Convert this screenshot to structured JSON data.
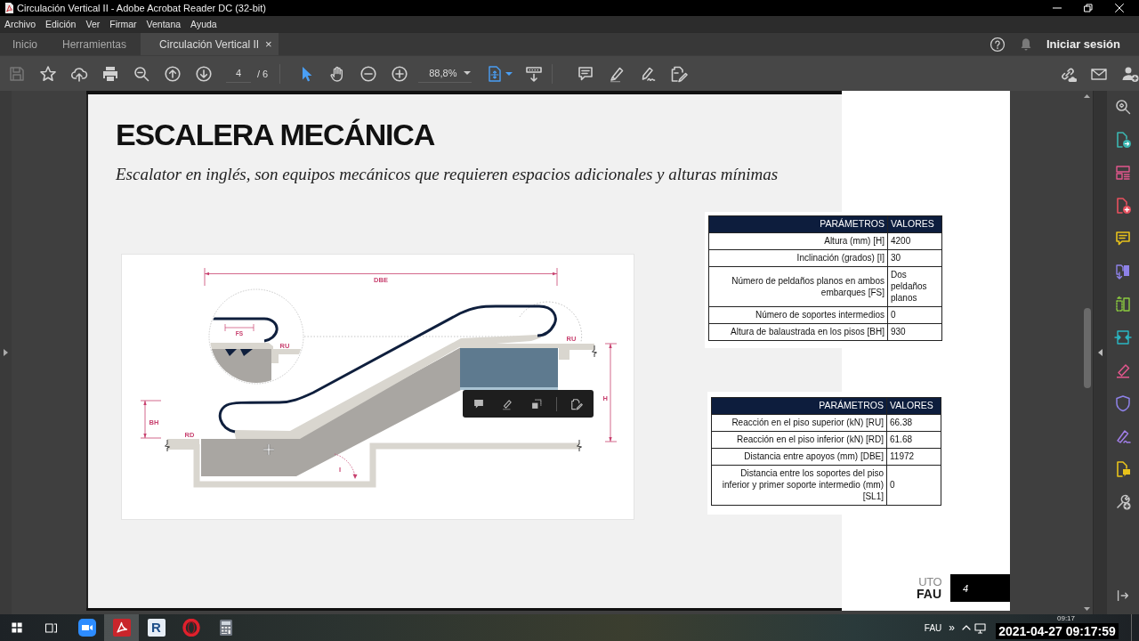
{
  "window": {
    "title": "Circulación Vertical II - Adobe Acrobat Reader DC (32-bit)"
  },
  "menu": [
    "Archivo",
    "Edición",
    "Ver",
    "Firmar",
    "Ventana",
    "Ayuda"
  ],
  "tabs": [
    {
      "label": "Inicio",
      "selected": false
    },
    {
      "label": "Herramientas",
      "selected": false
    },
    {
      "label": "Circulación Vertical II",
      "selected": true,
      "close": "×"
    }
  ],
  "account": {
    "sign_in": "Iniciar sesión"
  },
  "toolbar": {
    "save": {
      "disabled": true
    },
    "page": "4",
    "page_total": "/ 6",
    "pointer_tool": {
      "selected": true
    },
    "hand_tool": {
      "selected": false
    },
    "zoom": "88,8%"
  },
  "document": {
    "title": "ESCALERA MECÁNICA",
    "subtitle": "Escalator en inglés, son equipos mecánicos que requieren espacios adicionales y alturas mínimas",
    "diagram": {
      "labels": [
        "DBE",
        "FS",
        "RU",
        "BH",
        "RD",
        "RU",
        "H",
        "I"
      ]
    },
    "tables": [
      {
        "columns": [
          "PARÁMETROS",
          "VALORES"
        ],
        "rows": [
          [
            "Altura (mm) [H]",
            "4200"
          ],
          [
            "Inclinación (grados) [I]",
            "30"
          ],
          [
            "Número de peldaños planos en ambos embarques [FS]",
            "Dos peldaños planos"
          ],
          [
            "Número de soportes intermedios",
            "0"
          ],
          [
            "Altura de balaustrada en los pisos [BH]",
            "930"
          ]
        ]
      },
      {
        "columns": [
          "PARÁMETROS",
          "VALORES"
        ],
        "rows": [
          [
            "Reacción en el piso superior (kN) [RU]",
            "66.38"
          ],
          [
            "Reacción en el piso inferior (kN) [RD]",
            "61.68"
          ],
          [
            "Distancia entre apoyos (mm) [DBE]",
            "11972"
          ],
          [
            "Distancia entre los soportes del piso inferior y primer soporte intermedio (mm) [SL1]",
            "0"
          ]
        ]
      }
    ],
    "logo": [
      "UTO",
      "FAU"
    ],
    "page_number": "4"
  },
  "taskbar": {
    "apps": [
      {
        "kind": "video",
        "selected": false
      },
      {
        "kind": "pdf",
        "selected": true
      },
      {
        "kind": "letter",
        "letter": "R",
        "selected": false
      },
      {
        "kind": "browser",
        "selected": false
      },
      {
        "kind": "calculator",
        "selected": false
      }
    ],
    "language": "FAU",
    "overflow": "»",
    "clock": "09:17",
    "timestamp": "2021-04-27 09:17:59"
  }
}
